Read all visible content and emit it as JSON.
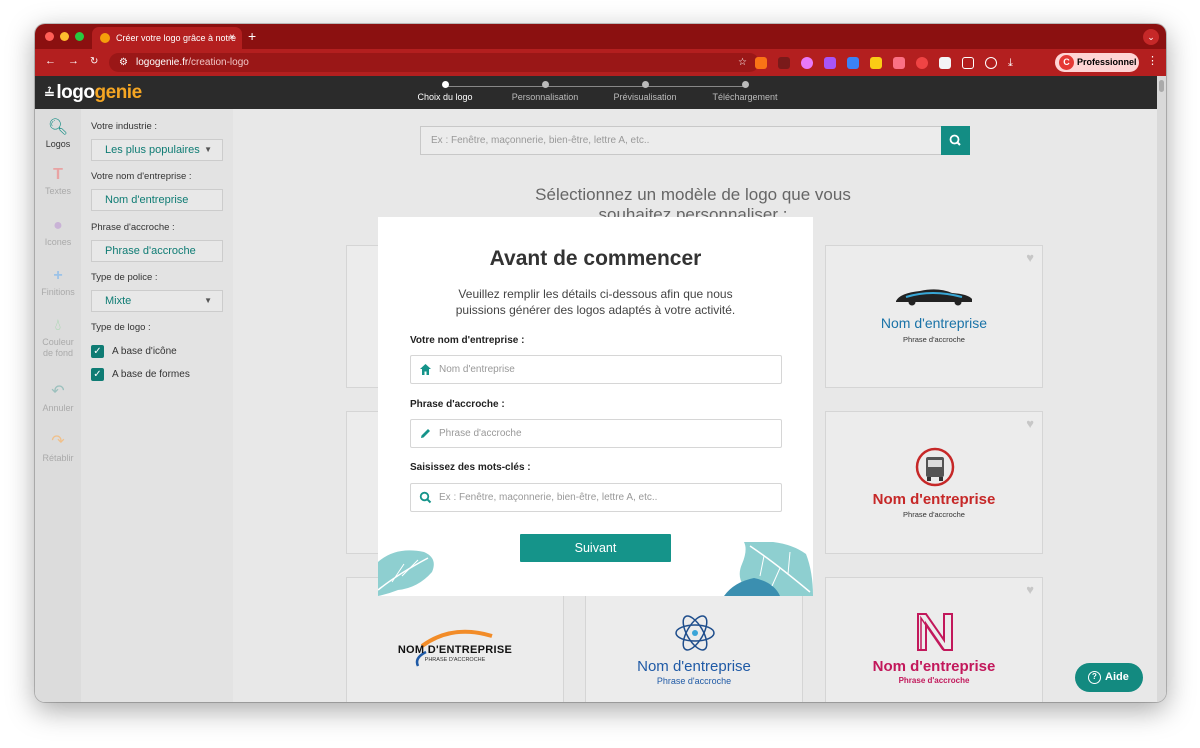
{
  "browser": {
    "tab_title": "Créer votre logo grâce à notre",
    "tab_close": "×",
    "new_tab": "+",
    "url_domain": "logogenie.fr",
    "url_path": "/creation-logo",
    "profile_initial": "C",
    "profile_label": "Professionnel"
  },
  "site": {
    "logo_part1": "logo",
    "logo_part2": "genie",
    "steps": [
      "Choix du logo",
      "Personnalisation",
      "Prévisualisation",
      "Téléchargement"
    ]
  },
  "iconbar": [
    {
      "label": "Logos",
      "icon": "magnifier-icon"
    },
    {
      "label": "Textes",
      "icon": "text-icon"
    },
    {
      "label": "Icones",
      "icon": "icons-icon"
    },
    {
      "label": "Finitions",
      "icon": "plus-icon"
    },
    {
      "label": "Couleur de fond",
      "icon": "drop-icon"
    },
    {
      "label": "Annuler",
      "icon": "undo-icon"
    },
    {
      "label": "Rétablir",
      "icon": "redo-icon"
    }
  ],
  "panel": {
    "industry_label": "Votre industrie :",
    "industry_value": "Les plus populaires",
    "name_label": "Votre nom d'entreprise :",
    "name_value": "Nom d'entreprise",
    "slogan_label": "Phrase d'accroche :",
    "slogan_value": "Phrase d'accroche",
    "font_label": "Type de police :",
    "font_value": "Mixte",
    "type_label": "Type de logo :",
    "check1": "A base d'icône",
    "check2": "A base de formes"
  },
  "main": {
    "search_placeholder": "Ex : Fenêtre, maçonnerie, bien-être, lettre A, etc..",
    "title": "Sélectionnez un modèle de logo que vous souhaitez personnaliser :",
    "card_name": "Nom d'entreprise",
    "card_slogan": "Phrase d'accroche",
    "card_name_upper": "NOM D'ENTREPRISE",
    "card_slogan_upper": "PHRASE D'ACCROCHE"
  },
  "modal": {
    "title": "Avant de commencer",
    "description": "Veuillez remplir les détails ci-dessous afin que nous puissions générer des logos adaptés à votre activité.",
    "name_label": "Votre nom d'entreprise :",
    "name_placeholder": "Nom d'entreprise",
    "slogan_label": "Phrase d'accroche :",
    "slogan_placeholder": "Phrase d'accroche",
    "keywords_label": "Saisissez des mots-clés :",
    "keywords_placeholder": "Ex : Fenêtre, maçonnerie, bien-être, lettre A, etc..",
    "next_button": "Suivant"
  },
  "help_button": "Aide",
  "colors": {
    "accent": "#15948a",
    "browser": "#b31f1f",
    "brand": "#f5a623"
  }
}
